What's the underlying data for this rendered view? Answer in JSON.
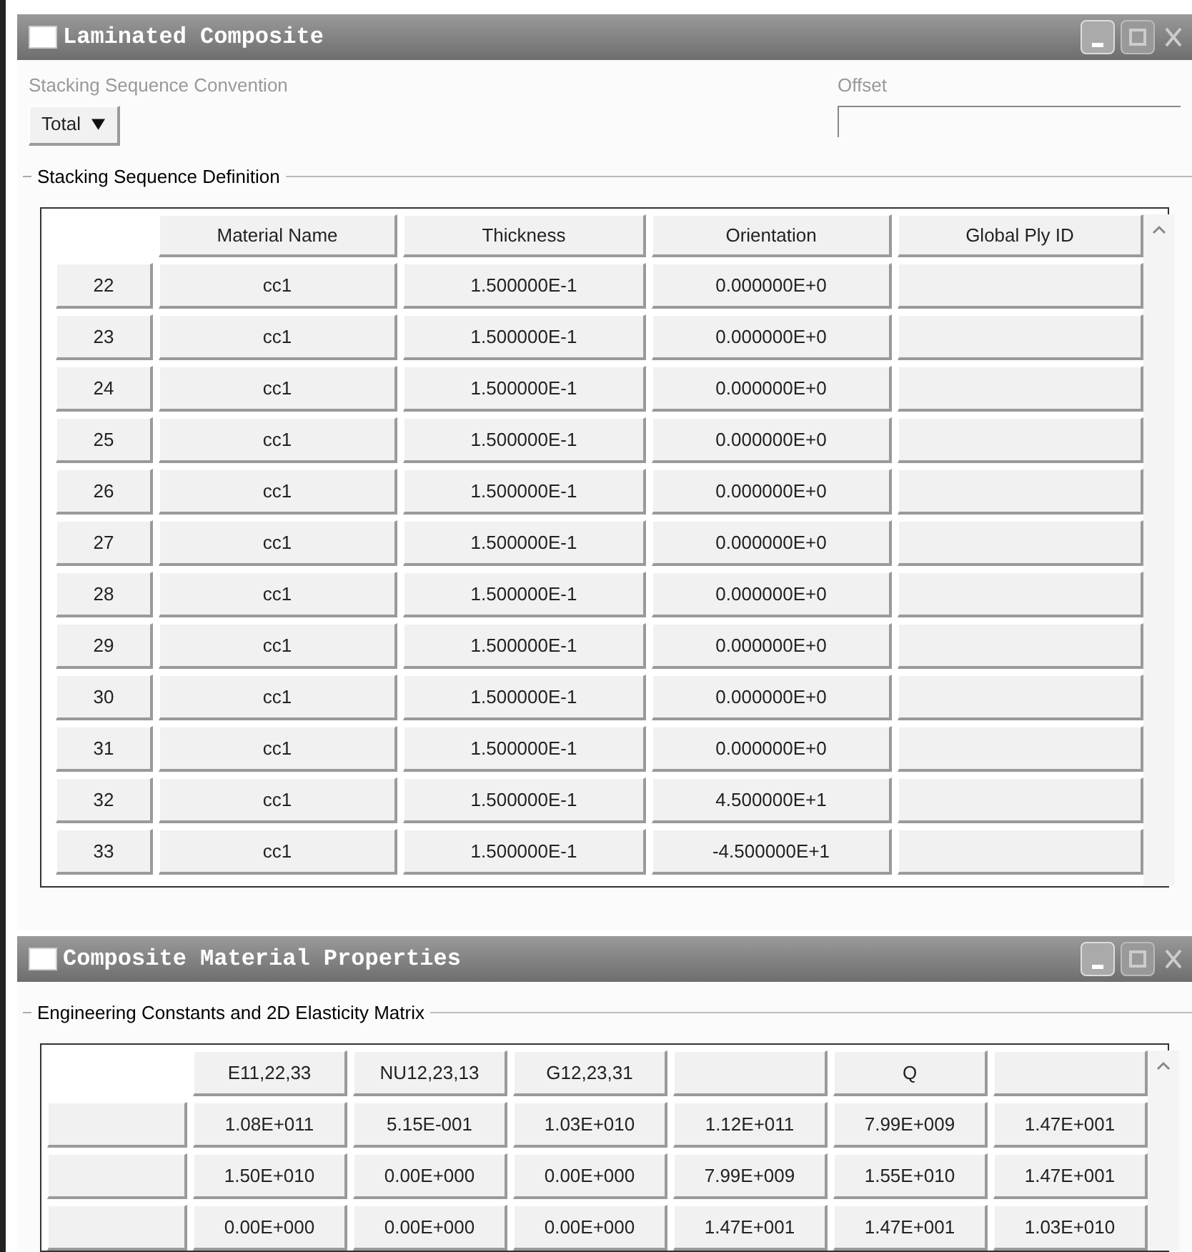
{
  "laminate_window": {
    "title": "Laminated Composite",
    "convention_label": "Stacking Sequence Convention",
    "convention_value": "Total",
    "offset_label": "Offset",
    "section_title": "Stacking Sequence Definition",
    "table": {
      "columns": [
        "Material Name",
        "Thickness",
        "Orientation",
        "Global Ply ID"
      ],
      "rows": [
        {
          "index": "22",
          "material": "cc1",
          "thickness": "1.500000E-1",
          "orientation": "0.000000E+0"
        },
        {
          "index": "23",
          "material": "cc1",
          "thickness": "1.500000E-1",
          "orientation": "0.000000E+0"
        },
        {
          "index": "24",
          "material": "cc1",
          "thickness": "1.500000E-1",
          "orientation": "0.000000E+0"
        },
        {
          "index": "25",
          "material": "cc1",
          "thickness": "1.500000E-1",
          "orientation": "0.000000E+0"
        },
        {
          "index": "26",
          "material": "cc1",
          "thickness": "1.500000E-1",
          "orientation": "0.000000E+0"
        },
        {
          "index": "27",
          "material": "cc1",
          "thickness": "1.500000E-1",
          "orientation": "0.000000E+0"
        },
        {
          "index": "28",
          "material": "cc1",
          "thickness": "1.500000E-1",
          "orientation": "0.000000E+0"
        },
        {
          "index": "29",
          "material": "cc1",
          "thickness": "1.500000E-1",
          "orientation": "0.000000E+0"
        },
        {
          "index": "30",
          "material": "cc1",
          "thickness": "1.500000E-1",
          "orientation": "0.000000E+0"
        },
        {
          "index": "31",
          "material": "cc1",
          "thickness": "1.500000E-1",
          "orientation": "0.000000E+0"
        },
        {
          "index": "32",
          "material": "cc1",
          "thickness": "1.500000E-1",
          "orientation": "4.500000E+1"
        },
        {
          "index": "33",
          "material": "cc1",
          "thickness": "1.500000E-1",
          "orientation": "-4.500000E+1"
        }
      ]
    }
  },
  "properties_window": {
    "title": "Composite Material Properties",
    "section_title": "Engineering Constants and 2D Elasticity Matrix",
    "table": {
      "columns": [
        "E11,22,33",
        "NU12,23,13",
        "G12,23,31",
        "",
        "Q",
        ""
      ],
      "rows": [
        [
          "1.08E+011",
          "5.15E-001",
          "1.03E+010",
          "1.12E+011",
          "7.99E+009",
          "1.47E+001"
        ],
        [
          "1.50E+010",
          "0.00E+000",
          "0.00E+000",
          "7.99E+009",
          "1.55E+010",
          "1.47E+001"
        ],
        [
          "0.00E+000",
          "0.00E+000",
          "0.00E+000",
          "1.47E+001",
          "1.47E+001",
          "1.03E+010"
        ]
      ]
    }
  }
}
